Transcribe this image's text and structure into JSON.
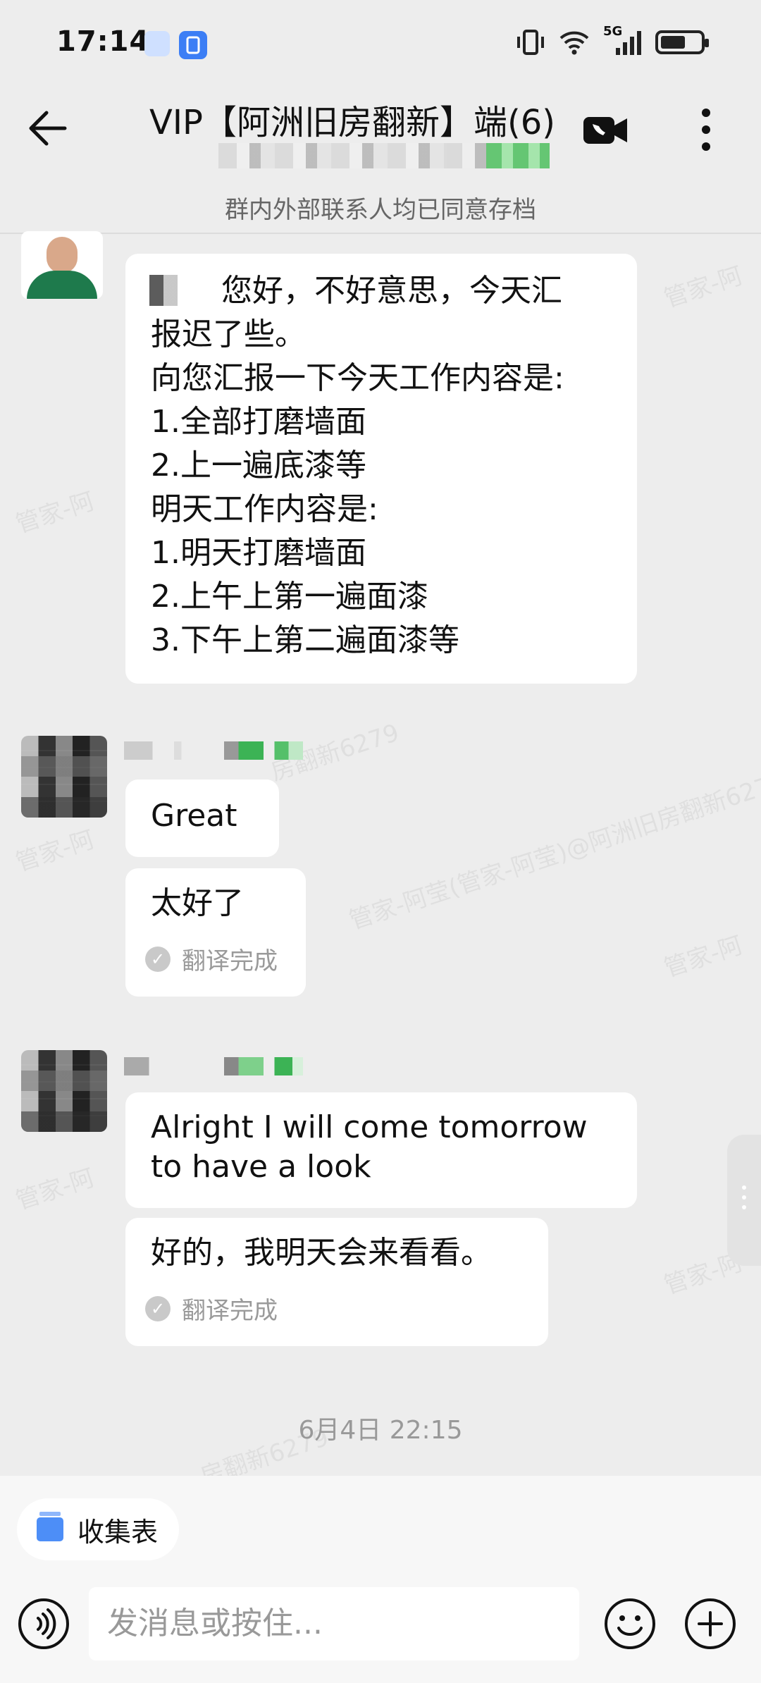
{
  "status": {
    "time": "17:14",
    "network": "5G"
  },
  "header": {
    "title": "VIP【阿洲旧房翻新】端(6)",
    "notice": "群内外部联系人均已同意存档"
  },
  "messages": [
    {
      "text": "您好，不好意思，今天汇\n报迟了些。\n向您汇报一下今天工作内容是:\n1.全部打磨墙面\n2.上一遍底漆等\n明天工作内容是:\n1.明天打磨墙面\n2.上午上第一遍面漆\n3.下午上第二遍面漆等"
    },
    {
      "text": "Great"
    },
    {
      "text": "太好了",
      "status": "翻译完成"
    },
    {
      "text": "Alright I will come tomorrow\nto have a look"
    },
    {
      "text": "好的，我明天会来看看。",
      "status": "翻译完成"
    }
  ],
  "timestamp": "6月4日  22:15",
  "watermark": "管家-阿莹(管家-阿莹)@阿洲旧房翻新6279",
  "bottom": {
    "chip_label": "收集表",
    "input_placeholder": "发消息或按住..."
  }
}
